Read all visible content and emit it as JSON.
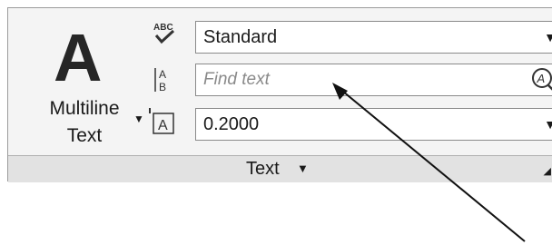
{
  "multiline_text": {
    "icon_glyph": "A",
    "label_line1": "Multiline",
    "label_line2": "Text"
  },
  "text_style": {
    "value": "Standard"
  },
  "find": {
    "placeholder": "Find text"
  },
  "text_height": {
    "value": "0.2000"
  },
  "panel": {
    "title": "Text"
  },
  "icons": {
    "spell_check": "spell-check-icon",
    "find_replace": "find-replace-icon",
    "text_height": "text-height-icon",
    "dropdown": "chevron-down-icon",
    "launcher": "panel-launcher-icon"
  },
  "colors": {
    "panel_bg": "#f4f4f4",
    "footer_bg": "#e2e2e2",
    "border": "#9c9c9c",
    "placeholder": "#8a8a8a"
  }
}
